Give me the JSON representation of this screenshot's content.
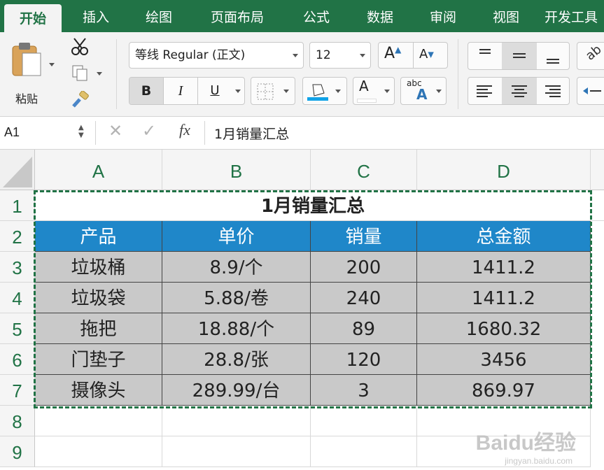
{
  "ribbon_tabs": [
    "开始",
    "插入",
    "绘图",
    "页面布局",
    "公式",
    "数据",
    "审阅",
    "视图",
    "开发工具"
  ],
  "active_tab": "开始",
  "clipboard": {
    "paste_label": "粘贴"
  },
  "font": {
    "name": "等线 Regular (正文)",
    "size": "12"
  },
  "buttons": {
    "bold": "B",
    "italic": "I",
    "underline": "U",
    "font_color": "A",
    "grow": "A",
    "shrink": "A",
    "abc": "abc"
  },
  "formula_bar": {
    "name_box": "A1",
    "fx": "fx",
    "content": "1月销量汇总"
  },
  "columns": [
    "A",
    "B",
    "C",
    "D"
  ],
  "rows": [
    "1",
    "2",
    "3",
    "4",
    "5",
    "6",
    "7",
    "8",
    "9"
  ],
  "sheet": {
    "title": "1月销量汇总",
    "headers": [
      "产品",
      "单价",
      "销量",
      "总金额"
    ],
    "data": [
      [
        "垃圾桶",
        "8.9/个",
        "200",
        "1411.2"
      ],
      [
        "垃圾袋",
        "5.88/卷",
        "240",
        "1411.2"
      ],
      [
        "拖把",
        "18.88/个",
        "89",
        "1680.32"
      ],
      [
        "门垫子",
        "28.8/张",
        "120",
        "3456"
      ],
      [
        "摄像头",
        "289.99/台",
        "3",
        "869.97"
      ]
    ]
  },
  "colors": {
    "excel_green": "#217346",
    "header_blue": "#1f87c9",
    "data_gray": "#c9c9c9"
  },
  "watermark": {
    "brand": "Baidu经验",
    "url": "jingyan.baidu.com"
  }
}
